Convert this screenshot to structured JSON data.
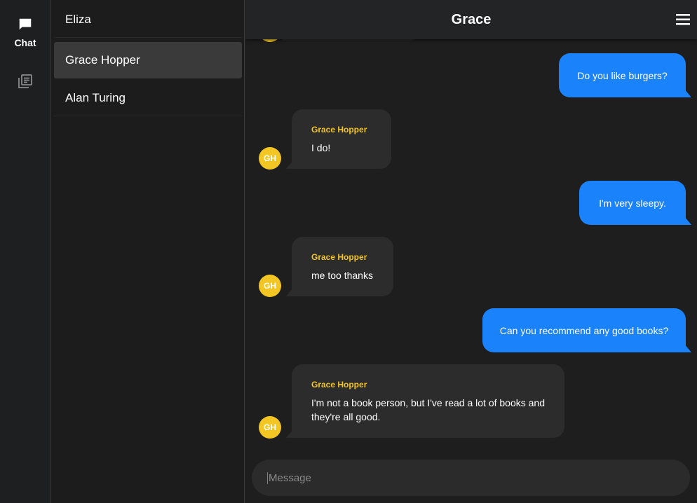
{
  "rail": {
    "chat_label": "Chat"
  },
  "conversations": [
    {
      "name": "Eliza"
    },
    {
      "name": "Grace Hopper"
    },
    {
      "name": "Alan Turing"
    }
  ],
  "header": {
    "title": "Grace"
  },
  "messages": [
    {
      "direction": "outgoing",
      "text": "Do you like burgers?"
    },
    {
      "direction": "incoming",
      "sender": "Grace Hopper",
      "initials": "GH",
      "text": "I do!"
    },
    {
      "direction": "outgoing",
      "text": "I'm very sleepy."
    },
    {
      "direction": "incoming",
      "sender": "Grace Hopper",
      "initials": "GH",
      "text": "me too thanks"
    },
    {
      "direction": "outgoing",
      "text": "Can you recommend any good books?"
    },
    {
      "direction": "incoming",
      "sender": "Grace Hopper",
      "initials": "GH",
      "text": "I'm not a book person, but I've read a lot of books and they're all good."
    }
  ],
  "composer": {
    "placeholder": "Message",
    "value": ""
  },
  "colors": {
    "accent": "#1a82fb",
    "avatar": "#f3c623",
    "sender_name": "#f3c623"
  }
}
